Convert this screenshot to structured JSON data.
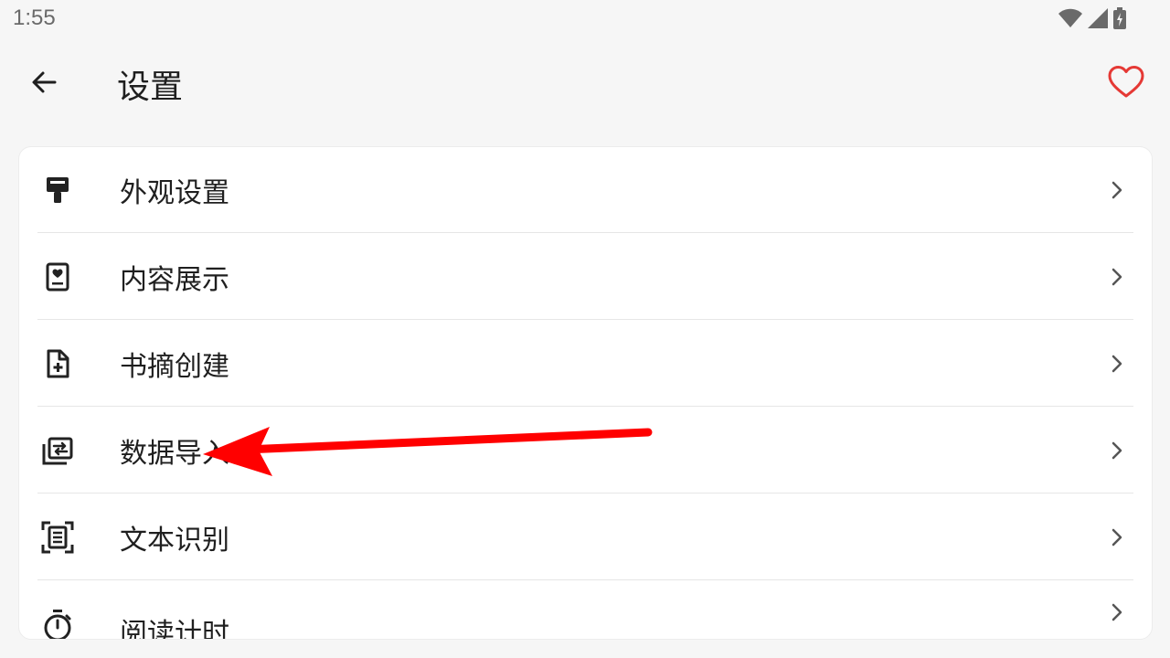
{
  "status_bar": {
    "time": "1:55",
    "icons": [
      "wifi-icon",
      "signal-icon",
      "battery-charging-icon"
    ]
  },
  "app_bar": {
    "title": "设置",
    "back_icon": "arrow-back-icon",
    "favorite_icon": "heart-outline-icon",
    "favorite_color": "#e53935"
  },
  "settings": {
    "items": [
      {
        "label": "外观设置",
        "icon": "paint-roller-icon"
      },
      {
        "label": "内容展示",
        "icon": "book-heart-icon"
      },
      {
        "label": "书摘创建",
        "icon": "note-add-icon"
      },
      {
        "label": "数据导入",
        "icon": "import-icon"
      },
      {
        "label": "文本识别",
        "icon": "document-scanner-icon"
      },
      {
        "label": "阅读计时",
        "icon": "timer-icon"
      }
    ]
  },
  "annotation": {
    "type": "arrow",
    "color": "#ff0000",
    "points_to": "数据导入"
  }
}
